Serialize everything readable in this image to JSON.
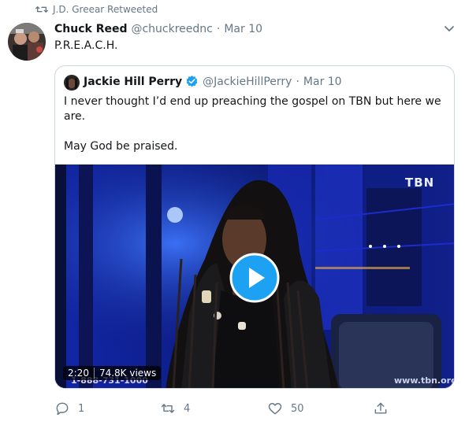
{
  "retweet_context": {
    "icon": "retweet-icon",
    "text": "J.D. Greear Retweeted"
  },
  "tweet": {
    "author_name": "Chuck Reed",
    "author_handle": "@chuckreednc",
    "separator": "·",
    "date": "Mar 10",
    "text": "P.R.E.A.C.H.",
    "menu_icon": "chevron-down-icon"
  },
  "quote": {
    "author_name": "Jackie Hill Perry",
    "verified_icon": "verified-badge-icon",
    "author_handle": "@JackieHillPerry",
    "separator": "·",
    "date": "Mar 10",
    "paragraph1": "I never thought I’d end up preaching the gospel on TBN but here we are.",
    "paragraph2": "May God be praised.",
    "video": {
      "duration": "2:20",
      "views": "74.8K views",
      "brand": "TBN",
      "site": "www.tbn.org",
      "phone": "1-888-731-1000",
      "play_icon": "play-icon"
    }
  },
  "actions": {
    "reply_count": "1",
    "retweet_count": "4",
    "like_count": "50",
    "icons": [
      "reply-icon",
      "retweet-icon",
      "like-icon",
      "share-icon"
    ]
  },
  "colors": {
    "accent": "#1da1f2",
    "muted": "#657786",
    "border": "#ccd6dd"
  }
}
